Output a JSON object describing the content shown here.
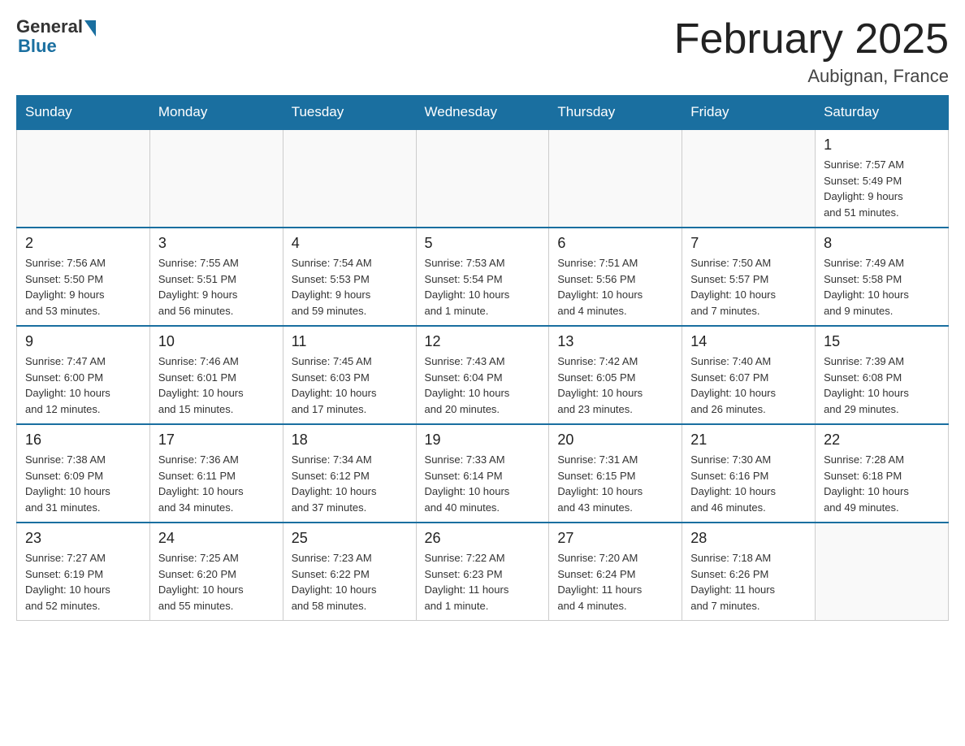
{
  "header": {
    "logo_general": "General",
    "logo_blue": "Blue",
    "month_title": "February 2025",
    "location": "Aubignan, France"
  },
  "weekdays": [
    "Sunday",
    "Monday",
    "Tuesday",
    "Wednesday",
    "Thursday",
    "Friday",
    "Saturday"
  ],
  "weeks": [
    [
      {
        "day": "",
        "info": ""
      },
      {
        "day": "",
        "info": ""
      },
      {
        "day": "",
        "info": ""
      },
      {
        "day": "",
        "info": ""
      },
      {
        "day": "",
        "info": ""
      },
      {
        "day": "",
        "info": ""
      },
      {
        "day": "1",
        "info": "Sunrise: 7:57 AM\nSunset: 5:49 PM\nDaylight: 9 hours\nand 51 minutes."
      }
    ],
    [
      {
        "day": "2",
        "info": "Sunrise: 7:56 AM\nSunset: 5:50 PM\nDaylight: 9 hours\nand 53 minutes."
      },
      {
        "day": "3",
        "info": "Sunrise: 7:55 AM\nSunset: 5:51 PM\nDaylight: 9 hours\nand 56 minutes."
      },
      {
        "day": "4",
        "info": "Sunrise: 7:54 AM\nSunset: 5:53 PM\nDaylight: 9 hours\nand 59 minutes."
      },
      {
        "day": "5",
        "info": "Sunrise: 7:53 AM\nSunset: 5:54 PM\nDaylight: 10 hours\nand 1 minute."
      },
      {
        "day": "6",
        "info": "Sunrise: 7:51 AM\nSunset: 5:56 PM\nDaylight: 10 hours\nand 4 minutes."
      },
      {
        "day": "7",
        "info": "Sunrise: 7:50 AM\nSunset: 5:57 PM\nDaylight: 10 hours\nand 7 minutes."
      },
      {
        "day": "8",
        "info": "Sunrise: 7:49 AM\nSunset: 5:58 PM\nDaylight: 10 hours\nand 9 minutes."
      }
    ],
    [
      {
        "day": "9",
        "info": "Sunrise: 7:47 AM\nSunset: 6:00 PM\nDaylight: 10 hours\nand 12 minutes."
      },
      {
        "day": "10",
        "info": "Sunrise: 7:46 AM\nSunset: 6:01 PM\nDaylight: 10 hours\nand 15 minutes."
      },
      {
        "day": "11",
        "info": "Sunrise: 7:45 AM\nSunset: 6:03 PM\nDaylight: 10 hours\nand 17 minutes."
      },
      {
        "day": "12",
        "info": "Sunrise: 7:43 AM\nSunset: 6:04 PM\nDaylight: 10 hours\nand 20 minutes."
      },
      {
        "day": "13",
        "info": "Sunrise: 7:42 AM\nSunset: 6:05 PM\nDaylight: 10 hours\nand 23 minutes."
      },
      {
        "day": "14",
        "info": "Sunrise: 7:40 AM\nSunset: 6:07 PM\nDaylight: 10 hours\nand 26 minutes."
      },
      {
        "day": "15",
        "info": "Sunrise: 7:39 AM\nSunset: 6:08 PM\nDaylight: 10 hours\nand 29 minutes."
      }
    ],
    [
      {
        "day": "16",
        "info": "Sunrise: 7:38 AM\nSunset: 6:09 PM\nDaylight: 10 hours\nand 31 minutes."
      },
      {
        "day": "17",
        "info": "Sunrise: 7:36 AM\nSunset: 6:11 PM\nDaylight: 10 hours\nand 34 minutes."
      },
      {
        "day": "18",
        "info": "Sunrise: 7:34 AM\nSunset: 6:12 PM\nDaylight: 10 hours\nand 37 minutes."
      },
      {
        "day": "19",
        "info": "Sunrise: 7:33 AM\nSunset: 6:14 PM\nDaylight: 10 hours\nand 40 minutes."
      },
      {
        "day": "20",
        "info": "Sunrise: 7:31 AM\nSunset: 6:15 PM\nDaylight: 10 hours\nand 43 minutes."
      },
      {
        "day": "21",
        "info": "Sunrise: 7:30 AM\nSunset: 6:16 PM\nDaylight: 10 hours\nand 46 minutes."
      },
      {
        "day": "22",
        "info": "Sunrise: 7:28 AM\nSunset: 6:18 PM\nDaylight: 10 hours\nand 49 minutes."
      }
    ],
    [
      {
        "day": "23",
        "info": "Sunrise: 7:27 AM\nSunset: 6:19 PM\nDaylight: 10 hours\nand 52 minutes."
      },
      {
        "day": "24",
        "info": "Sunrise: 7:25 AM\nSunset: 6:20 PM\nDaylight: 10 hours\nand 55 minutes."
      },
      {
        "day": "25",
        "info": "Sunrise: 7:23 AM\nSunset: 6:22 PM\nDaylight: 10 hours\nand 58 minutes."
      },
      {
        "day": "26",
        "info": "Sunrise: 7:22 AM\nSunset: 6:23 PM\nDaylight: 11 hours\nand 1 minute."
      },
      {
        "day": "27",
        "info": "Sunrise: 7:20 AM\nSunset: 6:24 PM\nDaylight: 11 hours\nand 4 minutes."
      },
      {
        "day": "28",
        "info": "Sunrise: 7:18 AM\nSunset: 6:26 PM\nDaylight: 11 hours\nand 7 minutes."
      },
      {
        "day": "",
        "info": ""
      }
    ]
  ]
}
